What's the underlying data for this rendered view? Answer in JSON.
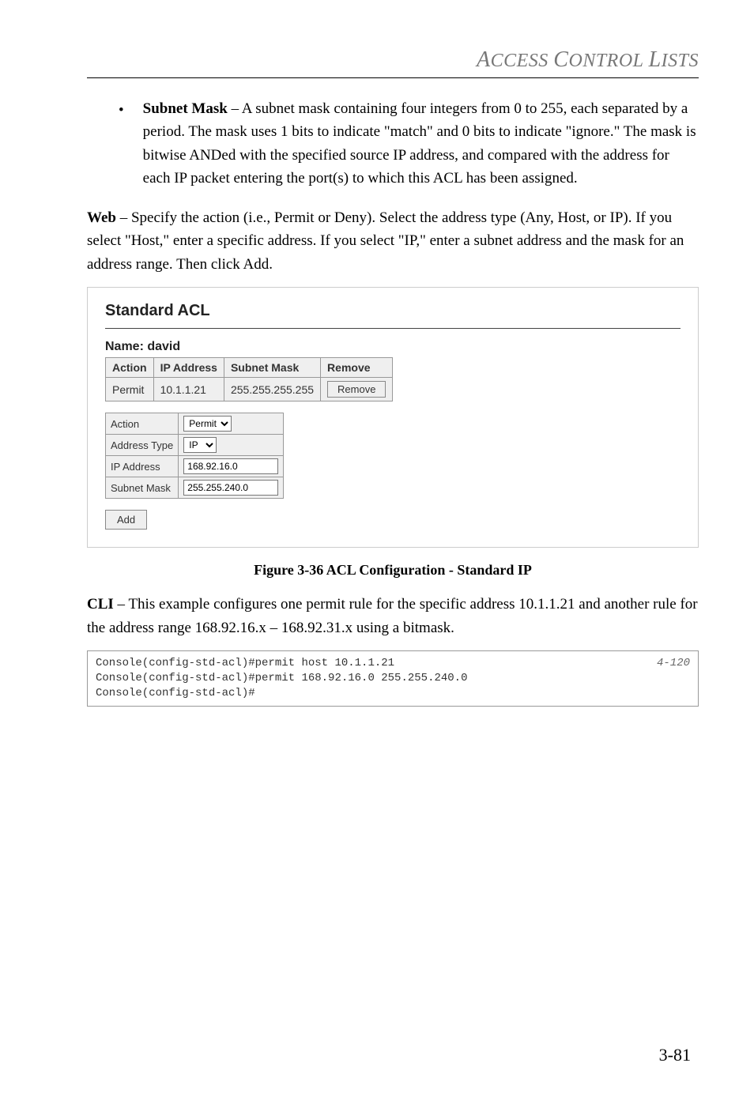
{
  "header": {
    "title": "ACCESS CONTROL LISTS"
  },
  "bullet": {
    "label": "Subnet Mask",
    "text": " – A subnet mask containing four integers from 0 to 255, each separated by a period. The mask uses 1 bits to indicate \"match\" and 0 bits to indicate \"ignore.\" The mask is bitwise ANDed with the specified source IP address, and compared with the address for each IP packet entering the port(s) to which this ACL has been assigned."
  },
  "web": {
    "label": "Web",
    "text": " – Specify the action (i.e., Permit or Deny). Select the address type (Any, Host, or IP). If you select \"Host,\" enter a specific address. If you select \"IP,\" enter a subnet address and the mask for an address range. Then click Add."
  },
  "figure": {
    "title": "Standard ACL",
    "name_label": "Name: david",
    "table": {
      "headers": [
        "Action",
        "IP Address",
        "Subnet Mask",
        "Remove"
      ],
      "row": {
        "action": "Permit",
        "ip": "10.1.1.21",
        "mask": "255.255.255.255",
        "remove_btn": "Remove"
      }
    },
    "form": {
      "action_label": "Action",
      "action_value": "Permit",
      "addr_type_label": "Address Type",
      "addr_type_value": "IP",
      "ip_label": "IP Address",
      "ip_value": "168.92.16.0",
      "mask_label": "Subnet Mask",
      "mask_value": "255.255.240.0"
    },
    "add_btn": "Add",
    "caption": "Figure 3-36  ACL Configuration - Standard IP"
  },
  "cli": {
    "label": "CLI",
    "text": " – This example configures one permit rule for the specific address 10.1.1.21 and another rule for the address range 168.92.16.x – 168.92.31.x using a bitmask."
  },
  "code": {
    "line1": "Console(config-std-acl)#permit host 10.1.1.21",
    "line2": "Console(config-std-acl)#permit 168.92.16.0 255.255.240.0",
    "line3": "Console(config-std-acl)#",
    "ref": "4-120"
  },
  "page_num": "3-81"
}
